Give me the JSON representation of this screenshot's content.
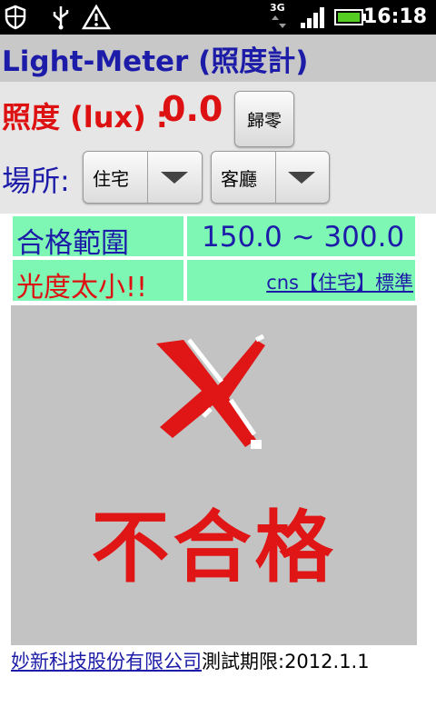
{
  "status_bar": {
    "time": "16:18",
    "network": "3G"
  },
  "app": {
    "title": "Light-Meter (照度計)"
  },
  "illuminance": {
    "label": "照度 (lux) :",
    "value": "0.0"
  },
  "zero_button": {
    "label": "歸零"
  },
  "place": {
    "label": "場所:",
    "category_selected": "住宅",
    "room_selected": "客廳"
  },
  "result_table": {
    "range_label": "合格範圍",
    "range_value": "150.0 ~ 300.0",
    "result_text": "光度太小!!",
    "standard_link": "cns【住宅】標準"
  },
  "result_image": {
    "text": "不合格"
  },
  "footer": {
    "company_link": "妙新科技股份有限公司",
    "expiry": "測試期限:2012.1.1"
  },
  "colors": {
    "blue": "#1c1ca8",
    "red": "#dd1111",
    "green_cell": "#7ff7b4",
    "image_bg": "#c3c3c3"
  }
}
